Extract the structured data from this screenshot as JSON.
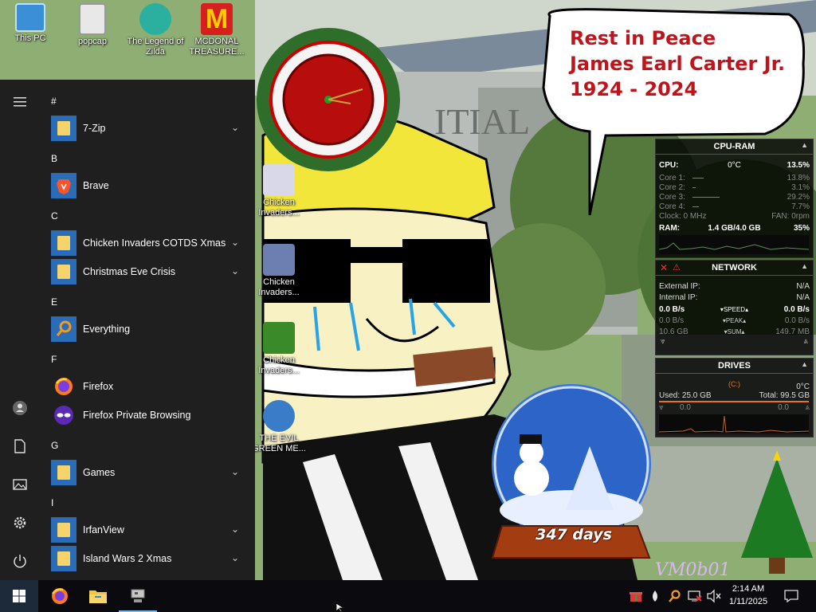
{
  "desktop": {
    "icons": [
      {
        "label": "This PC"
      },
      {
        "label": "popcap"
      },
      {
        "label": "The Legend of Zilda"
      },
      {
        "label": "MCDONAL TREASURE..."
      },
      {
        "label": "Chicken Invaders..."
      },
      {
        "label": "Chicken Invaders..."
      },
      {
        "label": "Chicken Invaders..."
      },
      {
        "label": "THE EVIL GREEN ME..."
      }
    ]
  },
  "wallpaper": {
    "speech_bubble": {
      "line1": "Rest in Peace",
      "line2": "James Earl Carter Jr.",
      "line3": "1924 - 2024"
    },
    "building_sign": "ITIAL",
    "countdown": "347 days",
    "signature": "VM0b01"
  },
  "start_menu": {
    "groups": [
      {
        "letter": "#",
        "apps": [
          {
            "name": "7-Zip",
            "icon": "folder-icon",
            "expandable": true
          }
        ]
      },
      {
        "letter": "B",
        "apps": [
          {
            "name": "Brave",
            "icon": "brave-icon",
            "expandable": false
          }
        ]
      },
      {
        "letter": "C",
        "apps": [
          {
            "name": "Chicken Invaders COTDS Xmas",
            "icon": "folder-icon",
            "expandable": true
          },
          {
            "name": "Christmas Eve Crisis",
            "icon": "folder-icon",
            "expandable": true
          }
        ]
      },
      {
        "letter": "E",
        "apps": [
          {
            "name": "Everything",
            "icon": "search-icon",
            "expandable": false
          }
        ]
      },
      {
        "letter": "F",
        "apps": [
          {
            "name": "Firefox",
            "icon": "firefox-icon",
            "expandable": false
          },
          {
            "name": "Firefox Private Browsing",
            "icon": "firefox-private-icon",
            "expandable": false
          }
        ]
      },
      {
        "letter": "G",
        "apps": [
          {
            "name": "Games",
            "icon": "folder-icon",
            "expandable": true
          }
        ]
      },
      {
        "letter": "I",
        "apps": [
          {
            "name": "IrfanView",
            "icon": "folder-icon",
            "expandable": true
          },
          {
            "name": "Island Wars 2 Xmas",
            "icon": "folder-icon",
            "expandable": true
          }
        ]
      }
    ],
    "rail": [
      "hamburger-icon",
      "user-icon",
      "documents-icon",
      "pictures-icon",
      "settings-icon",
      "power-icon"
    ]
  },
  "cpu_ram": {
    "title": "CPU-RAM",
    "cpu_label": "CPU:",
    "temp": "0°C",
    "cpu_pct": "13.5%",
    "cores": [
      {
        "label": "Core 1:",
        "value": "13.8%"
      },
      {
        "label": "Core 2:",
        "value": "3.1%"
      },
      {
        "label": "Core 3:",
        "value": "29.2%"
      },
      {
        "label": "Core 4:",
        "value": "7.7%"
      }
    ],
    "clock": "Clock: 0 MHz",
    "fan": "FAN: 0rpm",
    "ram_label": "RAM:",
    "ram_value": "1.4 GB/4.0 GB",
    "ram_pct": "35%"
  },
  "network": {
    "title": "NETWORK",
    "external_ip_label": "External IP:",
    "external_ip": "N/A",
    "internal_ip_label": "Internal IP:",
    "internal_ip": "N/A",
    "speed_down": "0.0 B/s",
    "speed_label": "SPEED",
    "speed_up": "0.0 B/s",
    "peak_down": "0.0 B/s",
    "peak_label": "PEAK",
    "peak_up": "0.0 B/s",
    "sum_down": "10.6 GB",
    "sum_label": "SUM",
    "sum_up": "149.7 MB"
  },
  "drives": {
    "title": "DRIVES",
    "drive": "(C:)",
    "temp": "0°C",
    "used": "Used: 25.0 GB",
    "total": "Total: 99.5 GB",
    "read": "0.0",
    "write": "0.0"
  },
  "taskbar": {
    "apps": [
      "windows-start-icon",
      "firefox-icon",
      "file-explorer-icon",
      "network-drive-icon"
    ],
    "tray": [
      "gift-icon",
      "drop-icon",
      "search-icon",
      "network-icon",
      "volume-muted-icon"
    ],
    "time": "2:14 AM",
    "date": "1/11/2025",
    "notification_icon": "notification-icon"
  }
}
